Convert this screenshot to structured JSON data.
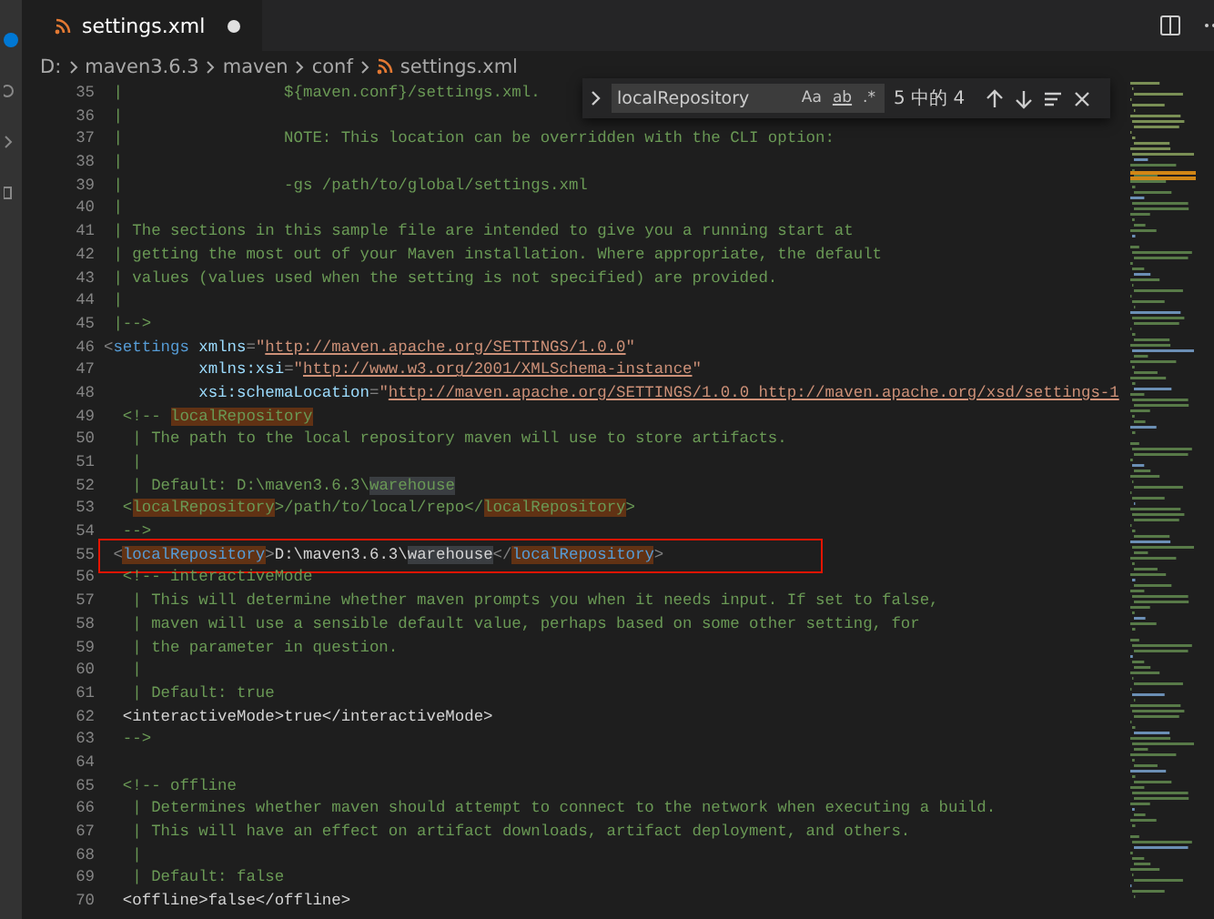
{
  "tab": {
    "label": "settings.xml",
    "modified": true
  },
  "breadcrumbs": [
    "D:",
    "maven3.6.3",
    "maven",
    "conf",
    "settings.xml"
  ],
  "find": {
    "value": "localRepository",
    "options": [
      {
        "label": "Aa",
        "selected": false
      },
      {
        "label": "ab",
        "selected": false
      },
      {
        "label": ".*",
        "selected": false
      }
    ],
    "count": "5 中的 4"
  },
  "lines": [
    {
      "number": "35",
      "boxed": false,
      "segments": [
        {
          "text": " |                 ${maven.conf}/settings.xml.",
          "kind": "comment",
          "match": false,
          "same_word": false
        }
      ]
    },
    {
      "number": "36",
      "boxed": false,
      "segments": [
        {
          "text": " |",
          "kind": "comment",
          "match": false,
          "same_word": false
        }
      ]
    },
    {
      "number": "37",
      "boxed": false,
      "segments": [
        {
          "text": " |                 NOTE: This location can be overridden with the CLI option:",
          "kind": "comment",
          "match": false,
          "same_word": false
        }
      ]
    },
    {
      "number": "38",
      "boxed": false,
      "segments": [
        {
          "text": " |",
          "kind": "comment",
          "match": false,
          "same_word": false
        }
      ]
    },
    {
      "number": "39",
      "boxed": false,
      "segments": [
        {
          "text": " |                 -gs /path/to/global/settings.xml",
          "kind": "comment",
          "match": false,
          "same_word": false
        }
      ]
    },
    {
      "number": "40",
      "boxed": false,
      "segments": [
        {
          "text": " |",
          "kind": "comment",
          "match": false,
          "same_word": false
        }
      ]
    },
    {
      "number": "41",
      "boxed": false,
      "segments": [
        {
          "text": " | The sections in this sample file are intended to give you a running start at",
          "kind": "comment",
          "match": false,
          "same_word": false
        }
      ]
    },
    {
      "number": "42",
      "boxed": false,
      "segments": [
        {
          "text": " | getting the most out of your Maven installation. Where appropriate, the default",
          "kind": "comment",
          "match": false,
          "same_word": false
        }
      ]
    },
    {
      "number": "43",
      "boxed": false,
      "segments": [
        {
          "text": " | values (values used when the setting is not specified) are provided.",
          "kind": "comment",
          "match": false,
          "same_word": false
        }
      ]
    },
    {
      "number": "44",
      "boxed": false,
      "segments": [
        {
          "text": " |",
          "kind": "comment",
          "match": false,
          "same_word": false
        }
      ]
    },
    {
      "number": "45",
      "boxed": false,
      "segments": [
        {
          "text": " |-->",
          "kind": "comment",
          "match": false,
          "same_word": false
        }
      ]
    },
    {
      "number": "46",
      "boxed": false,
      "segments": [
        {
          "text": "<",
          "kind": "punct",
          "match": false,
          "same_word": false
        },
        {
          "text": "settings",
          "kind": "tag",
          "match": false,
          "same_word": false
        },
        {
          "text": " xmlns",
          "kind": "attr",
          "match": false,
          "same_word": false
        },
        {
          "text": "=",
          "kind": "punct",
          "match": false,
          "same_word": false
        },
        {
          "text": "\"",
          "kind": "string",
          "match": false,
          "same_word": false
        },
        {
          "text": "http://maven.apache.org/SETTINGS/1.0.0",
          "kind": "url",
          "match": false,
          "same_word": false
        },
        {
          "text": "\"",
          "kind": "string",
          "match": false,
          "same_word": false
        }
      ]
    },
    {
      "number": "47",
      "boxed": false,
      "segments": [
        {
          "text": "          xmlns:xsi",
          "kind": "attr",
          "match": false,
          "same_word": false
        },
        {
          "text": "=",
          "kind": "punct",
          "match": false,
          "same_word": false
        },
        {
          "text": "\"",
          "kind": "string",
          "match": false,
          "same_word": false
        },
        {
          "text": "http://www.w3.org/2001/XMLSchema-instance",
          "kind": "url",
          "match": false,
          "same_word": false
        },
        {
          "text": "\"",
          "kind": "string",
          "match": false,
          "same_word": false
        }
      ]
    },
    {
      "number": "48",
      "boxed": false,
      "segments": [
        {
          "text": "          xsi:schemaLocation",
          "kind": "attr",
          "match": false,
          "same_word": false
        },
        {
          "text": "=",
          "kind": "punct",
          "match": false,
          "same_word": false
        },
        {
          "text": "\"",
          "kind": "string",
          "match": false,
          "same_word": false
        },
        {
          "text": "http://maven.apache.org/SETTINGS/1.0.0 http://maven.apache.org/xsd/settings-1",
          "kind": "url",
          "match": false,
          "same_word": false
        }
      ]
    },
    {
      "number": "49",
      "boxed": false,
      "segments": [
        {
          "text": "  <!-- ",
          "kind": "comment",
          "match": false,
          "same_word": false
        },
        {
          "text": "localRepository",
          "kind": "comment",
          "match": true,
          "same_word": false
        }
      ]
    },
    {
      "number": "50",
      "boxed": false,
      "segments": [
        {
          "text": "   | The path to the local repository maven will use to store artifacts.",
          "kind": "comment",
          "match": false,
          "same_word": false
        }
      ]
    },
    {
      "number": "51",
      "boxed": false,
      "segments": [
        {
          "text": "   |",
          "kind": "comment",
          "match": false,
          "same_word": false
        }
      ]
    },
    {
      "number": "52",
      "boxed": false,
      "segments": [
        {
          "text": "   | Default: D:\\maven3.6.3\\",
          "kind": "comment",
          "match": false,
          "same_word": false
        },
        {
          "text": "warehouse",
          "kind": "comment",
          "match": false,
          "same_word": true
        }
      ]
    },
    {
      "number": "53",
      "boxed": false,
      "segments": [
        {
          "text": "  <",
          "kind": "comment",
          "match": false,
          "same_word": false
        },
        {
          "text": "localRepository",
          "kind": "comment",
          "match": true,
          "same_word": false
        },
        {
          "text": ">/path/to/local/repo</",
          "kind": "comment",
          "match": false,
          "same_word": false
        },
        {
          "text": "localRepository",
          "kind": "comment",
          "match": true,
          "same_word": false
        },
        {
          "text": ">",
          "kind": "comment",
          "match": false,
          "same_word": false
        }
      ]
    },
    {
      "number": "54",
      "boxed": false,
      "segments": [
        {
          "text": "  -->",
          "kind": "comment",
          "match": false,
          "same_word": false
        }
      ]
    },
    {
      "number": "55",
      "boxed": true,
      "segments": [
        {
          "text": " <",
          "kind": "punct",
          "match": false,
          "same_word": false
        },
        {
          "text": "localRepository",
          "kind": "tag",
          "match": true,
          "same_word": false
        },
        {
          "text": ">",
          "kind": "punct",
          "match": false,
          "same_word": false
        },
        {
          "text": "D:\\maven3.6.3\\",
          "kind": "text",
          "match": false,
          "same_word": false
        },
        {
          "text": "warehouse",
          "kind": "text",
          "match": false,
          "same_word": true
        },
        {
          "text": "</",
          "kind": "punct",
          "match": false,
          "same_word": false
        },
        {
          "text": "localRepository",
          "kind": "tag",
          "match": true,
          "same_word": false
        },
        {
          "text": ">",
          "kind": "punct",
          "match": false,
          "same_word": false
        }
      ]
    },
    {
      "number": "56",
      "boxed": false,
      "segments": [
        {
          "text": "  <!-- interactiveMode",
          "kind": "comment",
          "match": false,
          "same_word": false
        }
      ]
    },
    {
      "number": "57",
      "boxed": false,
      "segments": [
        {
          "text": "   | This will determine whether maven prompts you when it needs input. If set to false,",
          "kind": "comment",
          "match": false,
          "same_word": false
        }
      ]
    },
    {
      "number": "58",
      "boxed": false,
      "segments": [
        {
          "text": "   | maven will use a sensible default value, perhaps based on some other setting, for",
          "kind": "comment",
          "match": false,
          "same_word": false
        }
      ]
    },
    {
      "number": "59",
      "boxed": false,
      "segments": [
        {
          "text": "   | the parameter in question.",
          "kind": "comment",
          "match": false,
          "same_word": false
        }
      ]
    },
    {
      "number": "60",
      "boxed": false,
      "segments": [
        {
          "text": "   |",
          "kind": "comment",
          "match": false,
          "same_word": false
        }
      ]
    },
    {
      "number": "61",
      "boxed": false,
      "segments": [
        {
          "text": "   | Default: true",
          "kind": "comment",
          "match": false,
          "same_word": false
        }
      ]
    },
    {
      "number": "62",
      "boxed": false,
      "segments": [
        {
          "text": "  <interactiveMode>true</interactiveMode>",
          "kind": "text",
          "match": false,
          "same_word": false
        }
      ]
    },
    {
      "number": "63",
      "boxed": false,
      "segments": [
        {
          "text": "  -->",
          "kind": "comment",
          "match": false,
          "same_word": false
        }
      ]
    },
    {
      "number": "64",
      "boxed": false
    },
    {
      "number": "65",
      "boxed": false,
      "segments": [
        {
          "text": "  <!-- offline",
          "kind": "comment",
          "match": false,
          "same_word": false
        }
      ]
    },
    {
      "number": "66",
      "boxed": false,
      "segments": [
        {
          "text": "   | Determines whether maven should attempt to connect to the network when executing a build.",
          "kind": "comment",
          "match": false,
          "same_word": false
        }
      ]
    },
    {
      "number": "67",
      "boxed": false,
      "segments": [
        {
          "text": "   | This will have an effect on artifact downloads, artifact deployment, and others.",
          "kind": "comment",
          "match": false,
          "same_word": false
        }
      ]
    },
    {
      "number": "68",
      "boxed": false,
      "segments": [
        {
          "text": "   |",
          "kind": "comment",
          "match": false,
          "same_word": false
        }
      ]
    },
    {
      "number": "69",
      "boxed": false,
      "segments": [
        {
          "text": "   | Default: false",
          "kind": "comment",
          "match": false,
          "same_word": false
        }
      ]
    },
    {
      "number": "70",
      "boxed": false,
      "segments": [
        {
          "text": "  <offline>false</offline>",
          "kind": "text",
          "match": false,
          "same_word": false
        }
      ]
    }
  ]
}
